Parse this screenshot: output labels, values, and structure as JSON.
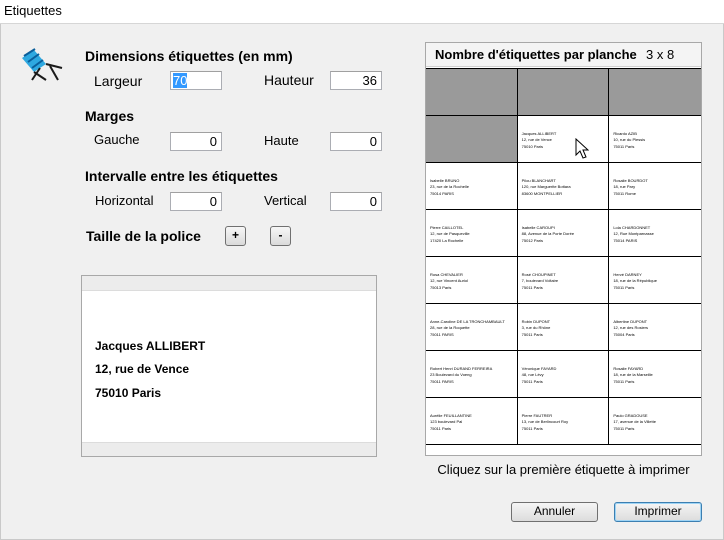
{
  "window": {
    "title": "Etiquettes"
  },
  "dimensions": {
    "title": "Dimensions étiquettes (en mm)",
    "width_label": "Largeur",
    "width_value": "70",
    "height_label": "Hauteur",
    "height_value": "36"
  },
  "margins": {
    "title": "Marges",
    "left_label": "Gauche",
    "left_value": "0",
    "top_label": "Haute",
    "top_value": "0"
  },
  "spacing": {
    "title": "Intervalle entre les étiquettes",
    "horizontal_label": "Horizontal",
    "horizontal_value": "0",
    "vertical_label": "Vertical",
    "vertical_value": "0"
  },
  "font_size": {
    "title": "Taille de la police",
    "plus": "+",
    "minus": "-"
  },
  "preview": {
    "lines": [
      "Jacques ALLIBERT",
      "12, rue de Vence",
      "75010 Paris"
    ]
  },
  "sheet": {
    "title": "Nombre d'étiquettes par planche",
    "layout": "3 x 8",
    "labels": [
      {
        "name": "",
        "street": "",
        "city": "",
        "used": true
      },
      {
        "name": "",
        "street": "",
        "city": "",
        "used": true
      },
      {
        "name": "",
        "street": "",
        "city": "",
        "used": true
      },
      {
        "name": "",
        "street": "",
        "city": "",
        "used": true
      },
      {
        "name": "Jacques ALLIBERT",
        "street": "12, rue de Vence",
        "city": "75010 Paris",
        "used": false
      },
      {
        "name": "Ricardo AZIB",
        "street": "10, rue du Plessis",
        "city": "75011 Paris",
        "used": false
      },
      {
        "name": "Isabelle BRUNO",
        "street": "23, rue de la Rochelle",
        "city": "75014 PARIS",
        "used": false
      },
      {
        "name": "Pilou BLANCHART",
        "street": "120, rue Marguerite Bottara",
        "city": "83600 MONTPELLIER",
        "used": false
      },
      {
        "name": "Rosalie BOURDOT",
        "street": "18, rue Pary",
        "city": "75011 Rome",
        "used": false
      },
      {
        "name": "Pierre CAILLOTEL",
        "street": "12, rue de Pasqueville",
        "city": "17420 La Rochelle",
        "used": false
      },
      {
        "name": "Isabelle CAROUPI",
        "street": "88, Avenue de la Porte Dorée",
        "city": "75012 Paris",
        "used": false
      },
      {
        "name": "Lola CHARDONNET",
        "street": "12, Rue Montparnasse",
        "city": "75014 PARIS",
        "used": false
      },
      {
        "name": "Rosa CHEVALIER",
        "street": "12, rue Vincent Auriol",
        "city": "75013 Paris",
        "used": false
      },
      {
        "name": "Rosé CHOUPINET",
        "street": "7, boulevard Voltaire",
        "city": "75011 Paris",
        "used": false
      },
      {
        "name": "Hervé DARNEY",
        "street": "18, rue de la République",
        "city": "75011 Paris",
        "used": false
      },
      {
        "name": "Anne-Caroline DE LA TRONCHAMBAULT",
        "street": "28, rue de la Roquette",
        "city": "75011 PARIS",
        "used": false
      },
      {
        "name": "Robin DUPONT",
        "street": "3, rue du Rhône",
        "city": "75011 Paris",
        "used": false
      },
      {
        "name": "Albertine DUPONT",
        "street": "12, rue des Rosiers",
        "city": "75004 Paris",
        "used": false
      },
      {
        "name": "Robert Henri DURAND FERREIRA",
        "street": "23 Boulevard du Voeng",
        "city": "75011 PARIS",
        "used": false
      },
      {
        "name": "Véronique FAYARD",
        "street": "48, rue Lévy",
        "city": "75011 Paris",
        "used": false
      },
      {
        "name": "Rosalie FAYARD",
        "street": "18, rue de la Marseille",
        "city": "75011 Paris",
        "used": false
      },
      {
        "name": "Aurélie FEUILLANTINE",
        "street": "123 boulevard Pal",
        "city": "75011 Paris",
        "used": false
      },
      {
        "name": "Pierre FAUTRER",
        "street": "13, rue de Berlincourt Roy",
        "city": "75011 Paris",
        "used": false
      },
      {
        "name": "Paulo GRADOUSE",
        "street": "17, avenue de la Villette",
        "city": "75011 Paris",
        "used": false
      }
    ]
  },
  "hint": "Cliquez sur la première étiquette à imprimer",
  "buttons": {
    "cancel": "Annuler",
    "print": "Imprimer"
  }
}
